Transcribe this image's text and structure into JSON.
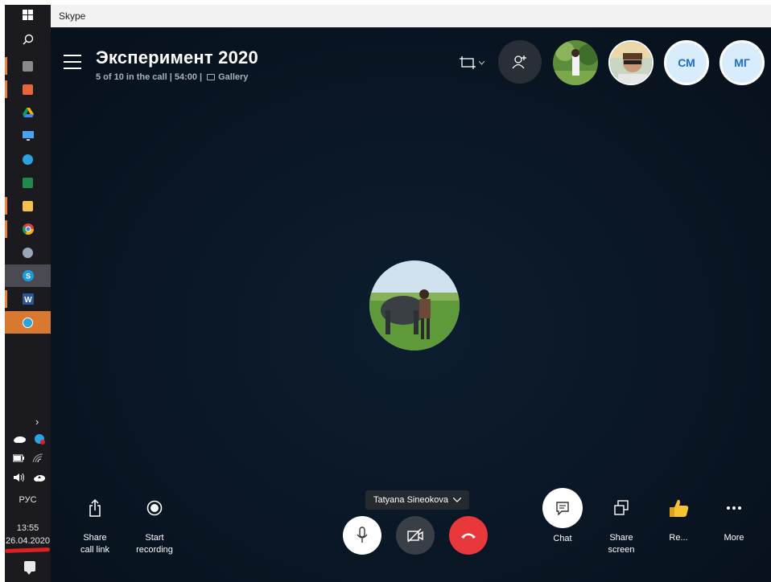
{
  "window": {
    "title": "Skype"
  },
  "taskbar": {
    "icons": [
      "windows-start-icon",
      "search-icon",
      "calculator-icon",
      "outlook-icon",
      "google-drive-icon",
      "this-pc-icon",
      "telegram-icon",
      "excel-icon",
      "file-explorer-icon",
      "chrome-icon",
      "paint-icon",
      "skype-icon",
      "word-icon",
      "telegram-icon"
    ],
    "language": "РУС",
    "time": "13:55",
    "date": "26.04.2020"
  },
  "call": {
    "title": "Эксперимент 2020",
    "status": "5 of 10 in the call | 54:00 |",
    "view": "Gallery",
    "participants_initials": [
      "СМ",
      "МГ"
    ],
    "speaker": "Tatyana Sineokova"
  },
  "controls": {
    "share_link": "Share call link",
    "start_recording": "Start recording",
    "chat": "Chat",
    "share_screen": "Share screen",
    "reactions": "Re...",
    "more": "More"
  },
  "colors": {
    "background": "#0a1624",
    "hangup": "#e8383b",
    "accent": "#1d6dd2",
    "taskbar_highlight": "#d9782f"
  }
}
